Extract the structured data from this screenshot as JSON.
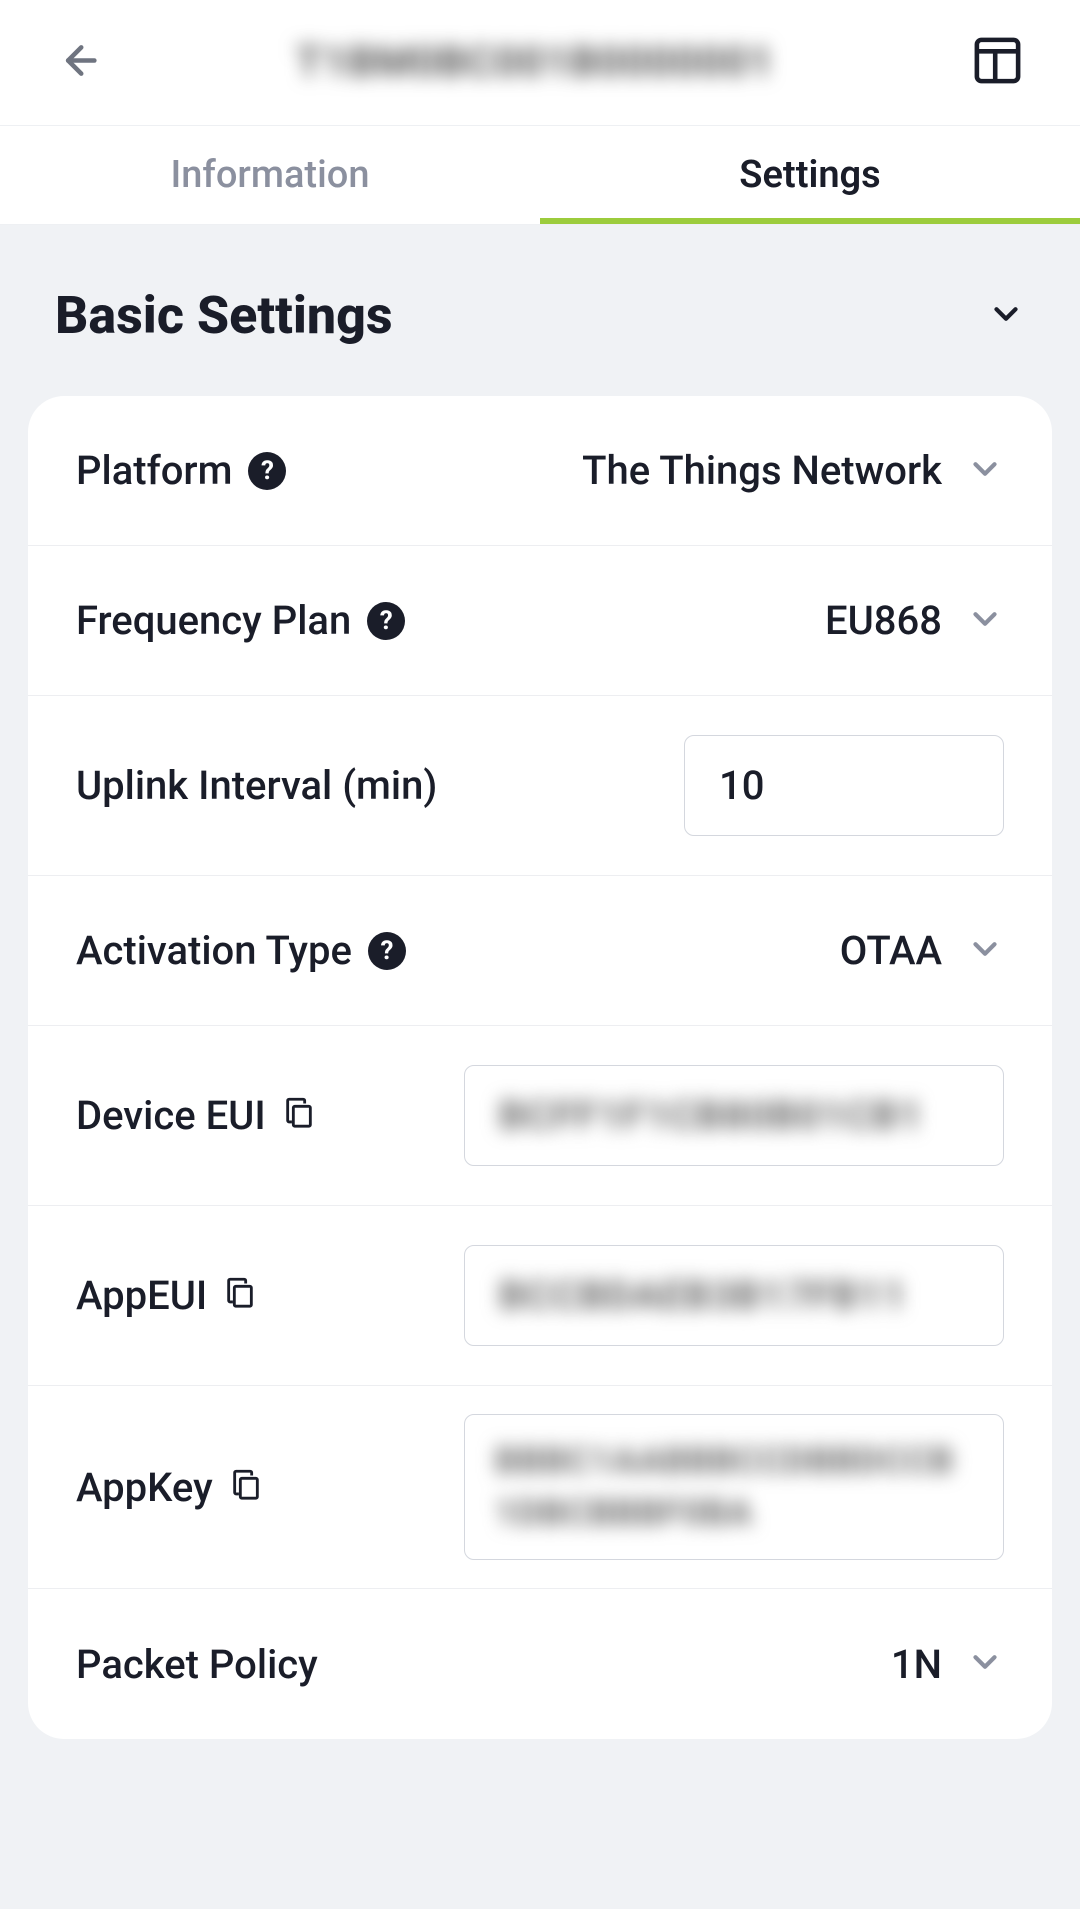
{
  "header": {
    "title_masked": "T1BM0BC001B0000001"
  },
  "tabs": {
    "information": "Information",
    "settings": "Settings"
  },
  "section": {
    "title": "Basic Settings"
  },
  "rows": {
    "platform": {
      "label": "Platform",
      "value": "The Things Network"
    },
    "frequency_plan": {
      "label": "Frequency Plan",
      "value": "EU868"
    },
    "uplink_interval": {
      "label": "Uplink Interval (min)",
      "value": "10"
    },
    "activation_type": {
      "label": "Activation Type",
      "value": "OTAA"
    },
    "device_eui": {
      "label": "Device EUI",
      "value_masked": "BCFF1F1CB80B01CB1"
    },
    "app_eui": {
      "label": "AppEUI",
      "value_masked": "BCCBDAEB3B17FB11"
    },
    "app_key": {
      "label": "AppKey",
      "value_masked": "BBBC1AABBBCCDBBDCCB1DBCBBBF0BA"
    },
    "packet_policy": {
      "label": "Packet Policy",
      "value": "1N"
    }
  }
}
